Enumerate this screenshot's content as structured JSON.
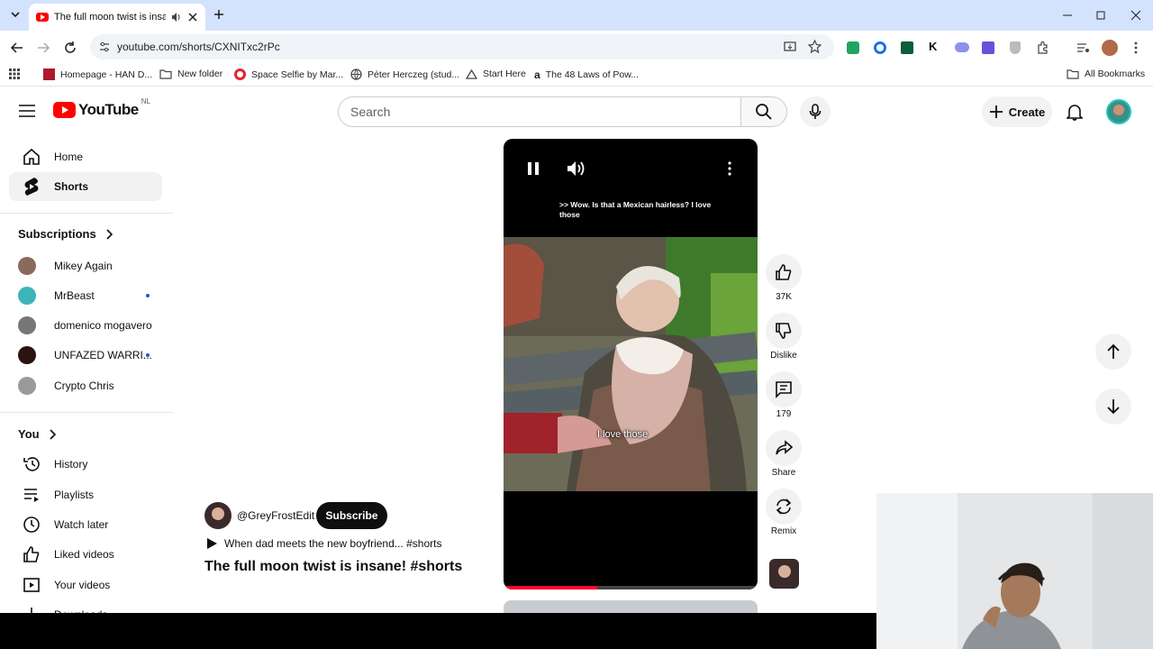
{
  "browser": {
    "tab_title": "The full moon twist is insane! #shorts",
    "url": "youtube.com/shorts/CXNITxc2rPc",
    "bookmarks": [
      "Homepage - HAN D...",
      "New folder",
      "Space Selfie by Mar...",
      "Péter Herczeg (stud...",
      "Start Here",
      "The 48 Laws of Pow..."
    ],
    "all_bookmarks": "All Bookmarks"
  },
  "youtube": {
    "logo_text": "YouTube",
    "region": "NL",
    "search_placeholder": "Search",
    "create_label": "Create"
  },
  "sidebar": {
    "home": "Home",
    "shorts": "Shorts",
    "subscriptions_heading": "Subscriptions",
    "subscriptions": [
      {
        "name": "Mikey Again",
        "new": false
      },
      {
        "name": "MrBeast",
        "new": true
      },
      {
        "name": "domenico mogavero",
        "new": false
      },
      {
        "name": "UNFAZED WARRI...",
        "new": true
      },
      {
        "name": "Crypto Chris",
        "new": false
      }
    ],
    "you_heading": "You",
    "you_items": [
      "History",
      "Playlists",
      "Watch later",
      "Liked videos",
      "Your videos",
      "Downloads"
    ]
  },
  "short": {
    "caption_top": ">> Wow. Is that a Mexican hairless? I love those",
    "caption_inline": "I love those",
    "channel": "@GreyFrostEdit",
    "subscribe_label": "Subscribe",
    "sound_label": "When dad meets the new boyfriend... #shorts",
    "title": "The full moon twist is insane! #shorts",
    "progress": 0.37,
    "likes": "37K",
    "dislike_label": "Dislike",
    "comments": "179",
    "share_label": "Share",
    "remix_label": "Remix"
  }
}
